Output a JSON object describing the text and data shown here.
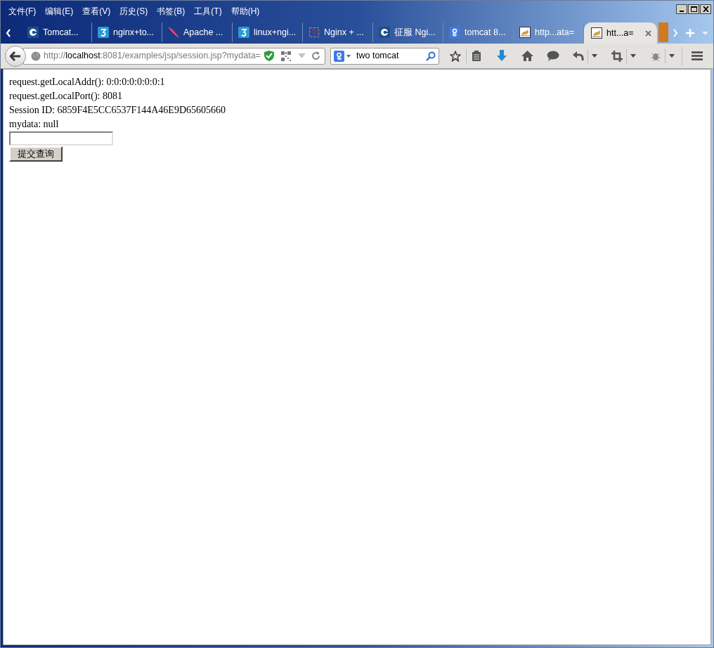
{
  "menu": [
    "文件(F)",
    "编辑(E)",
    "查看(V)",
    "历史(S)",
    "书签(B)",
    "工具(T)",
    "帮助(H)"
  ],
  "tabs": [
    {
      "label": "Tomcat...",
      "selected": false
    },
    {
      "label": "nginx+to...",
      "selected": false
    },
    {
      "label": "Apache ...",
      "selected": false
    },
    {
      "label": "linux+ngi...",
      "selected": false
    },
    {
      "label": "Nginx + ...",
      "selected": false
    },
    {
      "label": "征服 Ngi...",
      "selected": false
    },
    {
      "label": "tomcat 8...",
      "selected": false
    },
    {
      "label": "http...ata=",
      "selected": false
    },
    {
      "label": "htt...a=",
      "selected": true
    }
  ],
  "address": {
    "scheme": "http://",
    "host": "localhost",
    "rest": ":8081/examples/jsp/session.jsp?mydata="
  },
  "search": {
    "value": "two tomcat"
  },
  "lines": [
    "request.getLocalAddr(): 0:0:0:0:0:0:0:1",
    "request.getLocalPort(): 8081",
    "Session ID: 6859F4E5CC6537F144A46E9D65605660",
    "mydata: null"
  ],
  "submit_button": "提交查询"
}
